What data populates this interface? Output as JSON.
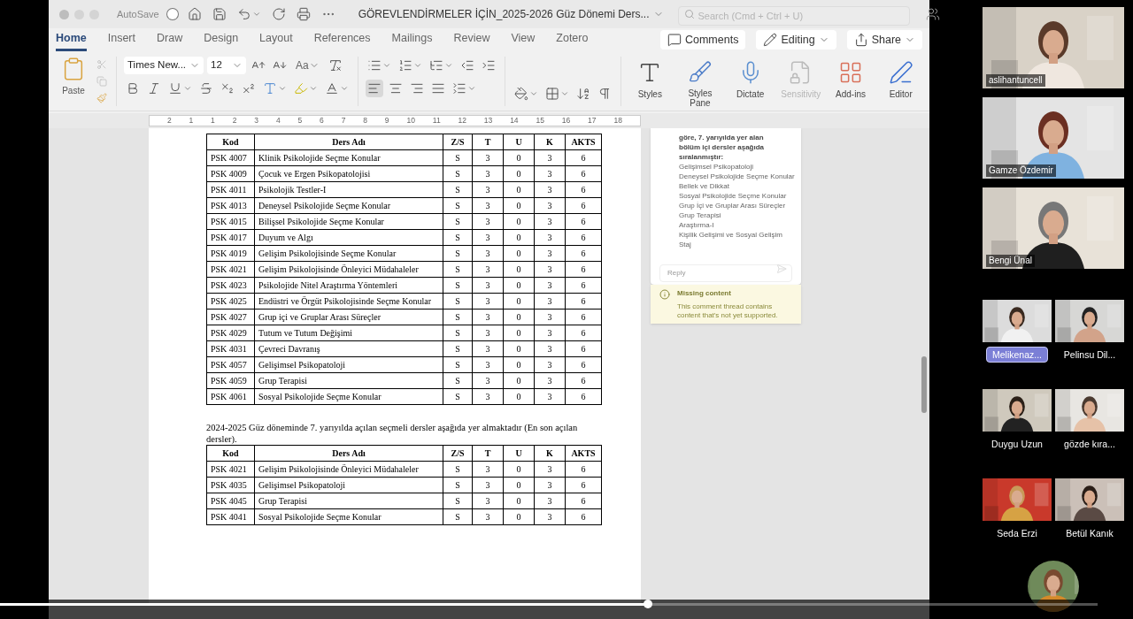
{
  "title_bar": {
    "autosave_label": "AutoSave",
    "autosave_on": false,
    "document_title": "GÖREVLENDİRMELER İÇİN_2025-2026 Güz Dönemi Ders...",
    "search_placeholder": "Search (Cmd + Ctrl + U)"
  },
  "ribbon_tabs": [
    {
      "label": "Home",
      "selected": true
    },
    {
      "label": "Insert",
      "selected": false
    },
    {
      "label": "Draw",
      "selected": false
    },
    {
      "label": "Design",
      "selected": false
    },
    {
      "label": "Layout",
      "selected": false
    },
    {
      "label": "References",
      "selected": false
    },
    {
      "label": "Mailings",
      "selected": false
    },
    {
      "label": "Review",
      "selected": false
    },
    {
      "label": "View",
      "selected": false
    },
    {
      "label": "Zotero",
      "selected": false
    }
  ],
  "ribbon_actions": [
    {
      "kind": "comments",
      "label": "Comments"
    },
    {
      "kind": "editing",
      "label": "Editing"
    },
    {
      "kind": "share",
      "label": "Share"
    }
  ],
  "ribbon": {
    "paste_label": "Paste",
    "font_name": "Times New...",
    "font_size": "12",
    "change_case": "Aa",
    "large_buttons": [
      {
        "kind": "styles",
        "label": "Styles",
        "disabled": false
      },
      {
        "kind": "pane",
        "label": "Styles Pane",
        "disabled": false
      },
      {
        "kind": "dictate",
        "label": "Dictate",
        "disabled": false
      },
      {
        "kind": "sensitivity",
        "label": "Sensitivity",
        "disabled": true
      },
      {
        "kind": "addins",
        "label": "Add-ins",
        "disabled": false
      },
      {
        "kind": "editor",
        "label": "Editor",
        "disabled": false
      }
    ]
  },
  "ruler": [
    "2",
    "1",
    "1",
    "2",
    "3",
    "4",
    "5",
    "6",
    "7",
    "8",
    "9",
    "10",
    "11",
    "12",
    "13",
    "14",
    "15",
    "16",
    "17",
    "18"
  ],
  "document": {
    "table_1": {
      "columns": [
        "Kod",
        "Ders Adı",
        "Z/S",
        "T",
        "U",
        "K",
        "AKTS"
      ],
      "rows": [
        [
          "PSK 4007",
          "Klinik Psikolojide Seçme Konular",
          "S",
          "3",
          "0",
          "3",
          "6"
        ],
        [
          "PSK 4009",
          "Çocuk ve Ergen Psikopatolojisi",
          "S",
          "3",
          "0",
          "3",
          "6"
        ],
        [
          "PSK 4011",
          "Psikolojik Testler-I",
          "S",
          "3",
          "0",
          "3",
          "6"
        ],
        [
          "PSK 4013",
          "Deneysel Psikolojide Seçme Konular",
          "S",
          "3",
          "0",
          "3",
          "6"
        ],
        [
          "PSK 4015",
          "Bilişsel Psikolojide Seçme Konular",
          "S",
          "3",
          "0",
          "3",
          "6"
        ],
        [
          "PSK 4017",
          "Duyum ve Algı",
          "S",
          "3",
          "0",
          "3",
          "6"
        ],
        [
          "PSK 4019",
          "Gelişim Psikolojisinde Seçme Konular",
          "S",
          "3",
          "0",
          "3",
          "6"
        ],
        [
          "PSK 4021",
          "Gelişim Psikolojisinde Önleyici Müdahaleler",
          "S",
          "3",
          "0",
          "3",
          "6"
        ],
        [
          "PSK 4023",
          "Psikolojide Nitel Araştırma Yöntemleri",
          "S",
          "3",
          "0",
          "3",
          "6"
        ],
        [
          "PSK 4025",
          "Endüstri ve Örgüt Psikolojisinde Seçme Konular",
          "S",
          "3",
          "0",
          "3",
          "6"
        ],
        [
          "PSK 4027",
          "Grup içi ve Gruplar Arası Süreçler",
          "S",
          "3",
          "0",
          "3",
          "6"
        ],
        [
          "PSK 4029",
          "Tutum ve Tutum Değişimi",
          "S",
          "3",
          "0",
          "3",
          "6"
        ],
        [
          "PSK 4031",
          "Çevreci Davranış",
          "S",
          "3",
          "0",
          "3",
          "6"
        ],
        [
          "PSK 4057",
          "Gelişimsel Psikopatoloji",
          "S",
          "3",
          "0",
          "3",
          "6"
        ],
        [
          "PSK 4059",
          "Grup Terapisi",
          "S",
          "3",
          "0",
          "3",
          "6"
        ],
        [
          "PSK 4061",
          "Sosyal Psikolojide Seçme Konular",
          "S",
          "3",
          "0",
          "3",
          "6"
        ]
      ]
    },
    "paragraph": "2024-2025 Güz döneminde 7. yarıyılda açılan seçmeli dersler aşağıda yer almaktadır (En son açılan dersler).",
    "table_2": {
      "columns": [
        "Kod",
        "Ders Adı",
        "Z/S",
        "T",
        "U",
        "K",
        "AKTS"
      ],
      "rows": [
        [
          "PSK 4021",
          "Gelişim Psikolojisinde Önleyici Müdahaleler",
          "S",
          "3",
          "0",
          "3",
          "6"
        ],
        [
          "PSK 4035",
          "Gelişimsel Psikopatoloji",
          "S",
          "3",
          "0",
          "3",
          "6"
        ],
        [
          "PSK 4045",
          "Grup Terapisi",
          "S",
          "3",
          "0",
          "3",
          "6"
        ],
        [
          "PSK 4041",
          "Sosyal Psikolojide Seçme Konular",
          "S",
          "3",
          "0",
          "3",
          "6"
        ]
      ]
    }
  },
  "comment": {
    "heading": "göre, 7. yarıyılda yer alan bölüm içi dersler aşağıda sıralanmıştır:",
    "items": [
      "Gelişimsel Psikopatoloji",
      "Deneysel Psikolojide Seçme Konular",
      "Bellek ve Dikkat",
      "Sosyal Psikolojide Seçme Konular",
      "Grup İçi ve Gruplar Arası Süreçler",
      "Grup Terapisi",
      "Araştırma-I",
      "Kişilik Gelişimi ve Sosyal Gelişim",
      "Staj"
    ],
    "reply_placeholder": "Reply",
    "notice_title": "Missing content",
    "notice_text": "This comment thread contains content that's not yet supported."
  },
  "participants": [
    {
      "kind": "large",
      "name": "aslihantuncell"
    },
    {
      "kind": "large",
      "name": "Gamze Özdemir"
    },
    {
      "kind": "large",
      "name": "Bengi Ünal"
    },
    {
      "kind": "small",
      "name": "Melikenaz...",
      "highlighted": true
    },
    {
      "kind": "small",
      "name": "Pelinsu Dil...",
      "highlighted": false
    },
    {
      "kind": "small",
      "name": "Duygu Uzun",
      "highlighted": false
    },
    {
      "kind": "small",
      "name": "gözde kıra...",
      "highlighted": false
    },
    {
      "kind": "small",
      "name": "Seda Erzi",
      "highlighted": false
    },
    {
      "kind": "small",
      "name": "Betül Kanık",
      "highlighted": false
    },
    {
      "kind": "round"
    }
  ],
  "playback": {
    "level": 0.59
  }
}
